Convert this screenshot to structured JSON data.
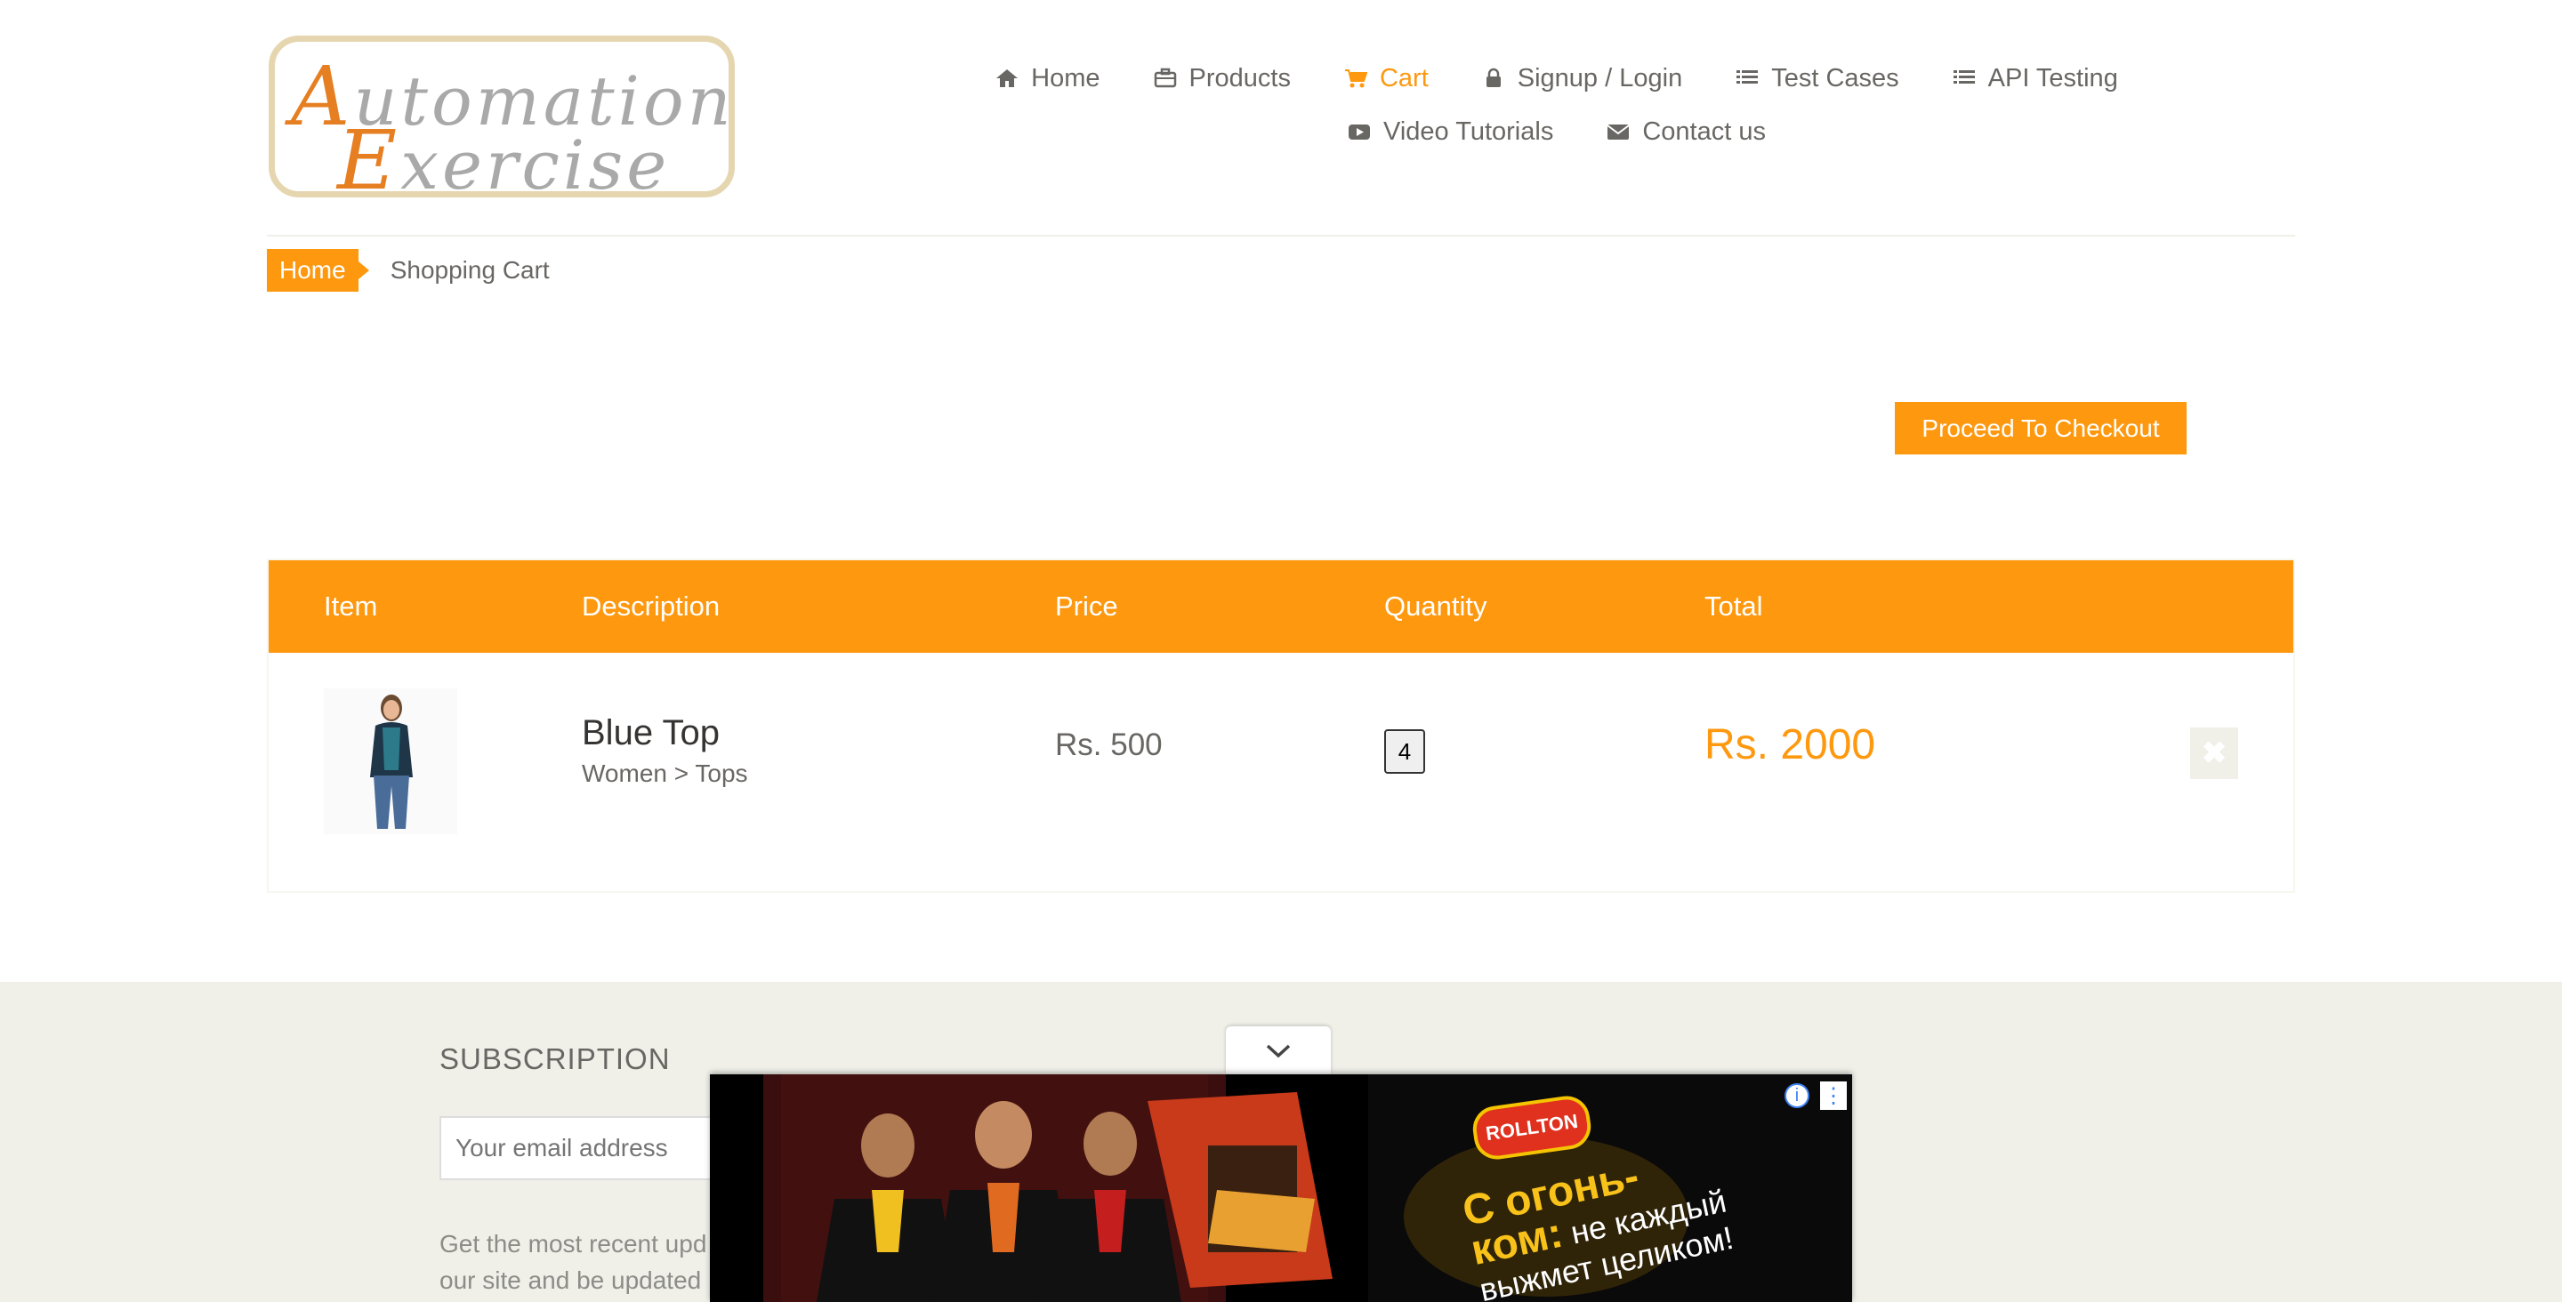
{
  "brand": {
    "line1": "Automation",
    "line2": "Exercise"
  },
  "nav": {
    "row1": [
      {
        "label": "Home",
        "icon": "home-icon"
      },
      {
        "label": "Products",
        "icon": "briefcase-icon"
      },
      {
        "label": "Cart",
        "icon": "cart-icon",
        "active": true
      },
      {
        "label": "Signup / Login",
        "icon": "lock-icon"
      },
      {
        "label": "Test Cases",
        "icon": "list-icon"
      },
      {
        "label": "API Testing",
        "icon": "list-icon"
      }
    ],
    "row2": [
      {
        "label": "Video Tutorials",
        "icon": "youtube-icon"
      },
      {
        "label": "Contact us",
        "icon": "envelope-icon"
      }
    ]
  },
  "breadcrumb": {
    "home": "Home",
    "current": "Shopping Cart"
  },
  "checkout": {
    "label": "Proceed To Checkout"
  },
  "cart": {
    "headers": {
      "item": "Item",
      "description": "Description",
      "price": "Price",
      "quantity": "Quantity",
      "total": "Total"
    },
    "rows": [
      {
        "name": "Blue Top",
        "category": "Women > Tops",
        "price": "Rs. 500",
        "quantity": "4",
        "total": "Rs. 2000",
        "delete_icon": "close-icon"
      }
    ]
  },
  "footer": {
    "subscription_title": "SUBSCRIPTION",
    "email_placeholder": "Your email address",
    "text_line1": "Get the most recent upd",
    "text_line2": "our site and be updated"
  },
  "ad": {
    "brand": "ROLLTON",
    "slogan_big": "С огонь-",
    "slogan_big2": "ком:",
    "slogan_small": "не каждый выжмет целиком!",
    "info_icon": "info-icon",
    "more_icon": "more-vert-icon"
  },
  "colors": {
    "accent": "#fe980f",
    "text": "#696763",
    "footer_bg": "#f0f0e9"
  }
}
